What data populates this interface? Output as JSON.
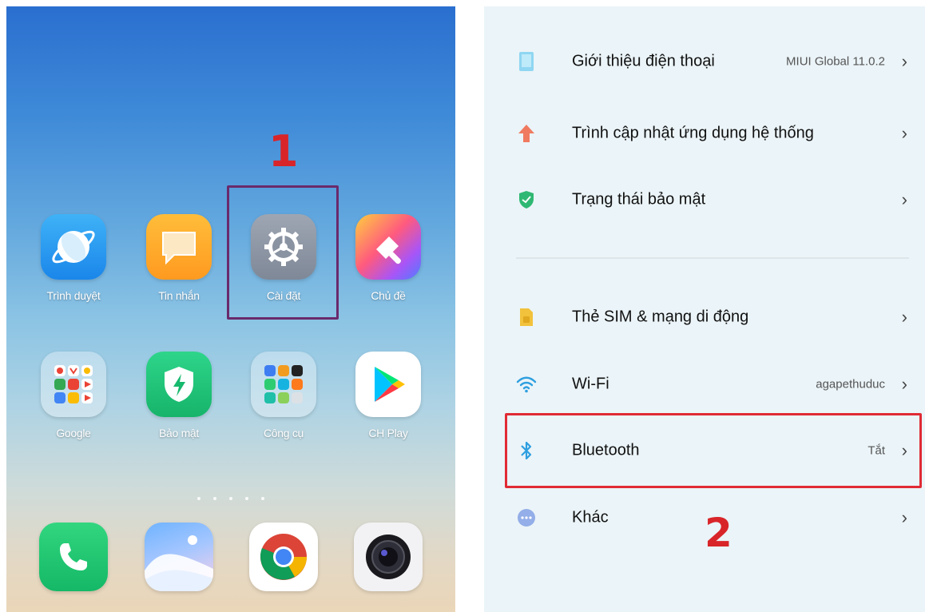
{
  "home_screen": {
    "apps_row1": [
      {
        "label": "Trình duyệt",
        "icon": "browser-icon"
      },
      {
        "label": "Tin nhắn",
        "icon": "messages-icon"
      },
      {
        "label": "Cài đặt",
        "icon": "settings-gear-icon"
      },
      {
        "label": "Chủ đề",
        "icon": "themes-icon"
      }
    ],
    "apps_row2": [
      {
        "label": "Google",
        "icon": "google-folder-icon"
      },
      {
        "label": "Bảo mật",
        "icon": "security-icon"
      },
      {
        "label": "Công cụ",
        "icon": "tools-folder-icon"
      },
      {
        "label": "CH Play",
        "icon": "play-store-icon"
      }
    ],
    "dock": [
      {
        "icon": "phone-icon"
      },
      {
        "icon": "gallery-icon"
      },
      {
        "icon": "chrome-icon"
      },
      {
        "icon": "camera-icon"
      }
    ],
    "page_dots": 5,
    "annotation": "1"
  },
  "settings": {
    "items": [
      {
        "title": "Giới thiệu điện thoại",
        "value": "MIUI Global 11.0.2",
        "icon": "phone-info-icon"
      },
      {
        "title": "Trình cập nhật ứng dụng hệ thống",
        "value": "",
        "icon": "update-arrow-icon"
      },
      {
        "title": "Trạng thái bảo mật",
        "value": "",
        "icon": "security-shield-icon"
      },
      {
        "title": "Thẻ SIM & mạng di động",
        "value": "",
        "icon": "sim-card-icon"
      },
      {
        "title": "Wi-Fi",
        "value": "agapethuduc",
        "icon": "wifi-icon"
      },
      {
        "title": "Bluetooth",
        "value": "Tắt",
        "icon": "bluetooth-icon"
      },
      {
        "title": "Khác",
        "value": "",
        "icon": "more-icon"
      }
    ],
    "chevron": "›",
    "annotation": "2"
  },
  "colors": {
    "annotation_red": "#d8252a",
    "highlight_purple": "#6a2a6c",
    "highlight_red": "#e02b35"
  }
}
